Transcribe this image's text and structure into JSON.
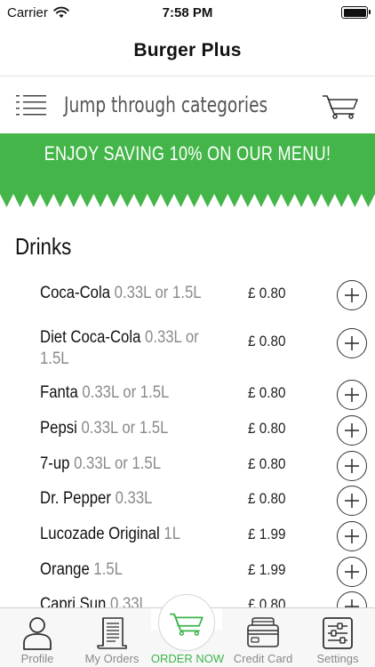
{
  "status_bar": {
    "carrier": "Carrier",
    "time": "7:58 PM"
  },
  "header": {
    "title": "Burger Plus"
  },
  "category_bar": {
    "label": "Jump through categories",
    "menu_icon": "list-icon",
    "cart_icon": "cart-icon"
  },
  "banner": {
    "text": "ENJOY SAVING 10% ON OUR MENU!",
    "color": "#44b649"
  },
  "section": {
    "title": "Drinks"
  },
  "items": [
    {
      "name": "Coca-Cola",
      "size": "0.33L or 1.5L",
      "price": "£ 0.80"
    },
    {
      "name": "Diet Coca-Cola",
      "size": "0.33L or 1.5L",
      "price": "£ 0.80"
    },
    {
      "name": "Fanta",
      "size": "0.33L or 1.5L",
      "price": "£ 0.80"
    },
    {
      "name": "Pepsi",
      "size": "0.33L or 1.5L",
      "price": "£ 0.80"
    },
    {
      "name": "7-up",
      "size": "0.33L or 1.5L",
      "price": "£ 0.80"
    },
    {
      "name": "Dr. Pepper",
      "size": "0.33L",
      "price": "£ 0.80"
    },
    {
      "name": "Lucozade Original",
      "size": "1L",
      "price": "£ 1.99"
    },
    {
      "name": "Orange",
      "size": "1.5L",
      "price": "£ 1.99"
    },
    {
      "name": "Capri Sun",
      "size": "0.33L",
      "price": "£ 0.80"
    }
  ],
  "tab_bar": {
    "tabs": [
      {
        "label": "Profile",
        "icon": "person-icon"
      },
      {
        "label": "My Orders",
        "icon": "receipt-icon"
      },
      {
        "label": "ORDER NOW",
        "icon": "cart-icon",
        "active": true
      },
      {
        "label": "Credit Card",
        "icon": "credit-card-icon"
      },
      {
        "label": "Settings",
        "icon": "sliders-icon"
      }
    ],
    "active_color": "#3bb54a"
  }
}
